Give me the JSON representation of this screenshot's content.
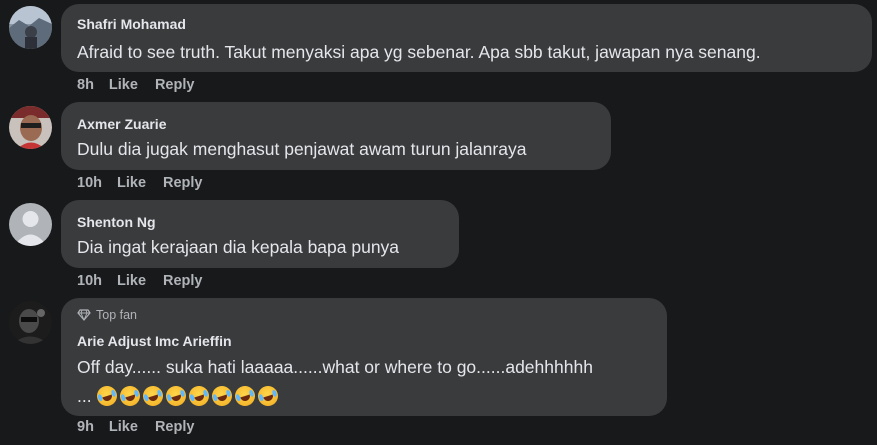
{
  "comments": [
    {
      "name": "Shafri Mohamad",
      "text": "Afraid to see truth. Takut menyaksi apa yg sebenar. Apa sbb takut, jawapan nya senang.",
      "time": "8h",
      "like": "Like",
      "reply": "Reply"
    },
    {
      "name": "Axmer Zuarie",
      "text": "Dulu dia jugak menghasut penjawat awam turun jalanraya",
      "time": "10h",
      "like": "Like",
      "reply": "Reply"
    },
    {
      "name": "Shenton Ng",
      "text": "Dia ingat kerajaan dia kepala bapa punya",
      "time": "10h",
      "like": "Like",
      "reply": "Reply"
    },
    {
      "badge": "Top fan",
      "name": "Arie Adjust Imc Arieffin",
      "text": "Off day...... suka hati laaaaa......what or where to go......adehhhhhh",
      "text2": "...",
      "emoji_count": 8,
      "emoji_icon": "rolling-on-floor-laughing-emoji",
      "time": "9h",
      "like": "Like",
      "reply": "Reply"
    }
  ]
}
